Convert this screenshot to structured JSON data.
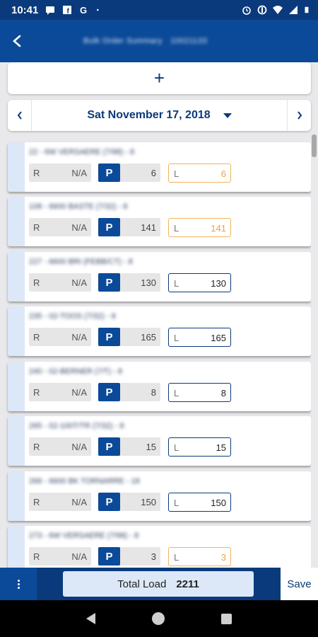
{
  "status_bar": {
    "time": "10:41",
    "left_icons": [
      "message-icon",
      "facebook-icon",
      "google-icon",
      "dot-icon"
    ],
    "right_icons": [
      "alarm-icon",
      "data-saver-icon",
      "wifi-icon",
      "signal-icon",
      "battery-icon"
    ]
  },
  "header": {
    "title": "Bulk Order Summary",
    "subtitle": "10021133"
  },
  "add_button": {
    "label": "+"
  },
  "date_nav": {
    "date": "Sat November 17, 2018",
    "prev_icon": "‹",
    "next_icon": "›"
  },
  "items": [
    {
      "name": "22 - 6W VERSAERE (7/98) - 8",
      "r_label": "R",
      "r_value": "N/A",
      "p_label": "P",
      "p_value": "6",
      "l_label": "L",
      "l_value": "6",
      "warn": true
    },
    {
      "name": "108 - 6600 BASTE (7/32) - 8",
      "r_label": "R",
      "r_value": "N/A",
      "p_label": "P",
      "p_value": "141",
      "l_label": "L",
      "l_value": "141",
      "warn": true
    },
    {
      "name": "227 - 6600 BRI (FEBB/CT) - 8",
      "r_label": "R",
      "r_value": "N/A",
      "p_label": "P",
      "p_value": "130",
      "l_label": "L",
      "l_value": "130",
      "warn": false
    },
    {
      "name": "235 - 02-TOOS (7/32) - 8",
      "r_label": "R",
      "r_value": "N/A",
      "p_label": "P",
      "p_value": "165",
      "l_label": "L",
      "l_value": "165",
      "warn": false
    },
    {
      "name": "240 - 02-BERNER (7/T) - 8",
      "r_label": "R",
      "r_value": "N/A",
      "p_label": "P",
      "p_value": "8",
      "l_label": "L",
      "l_value": "8",
      "warn": false
    },
    {
      "name": "265 - 02-100T/TR (7/32) - 8",
      "r_label": "R",
      "r_value": "N/A",
      "p_label": "P",
      "p_value": "15",
      "l_label": "L",
      "l_value": "15",
      "warn": false
    },
    {
      "name": "266 - 6600 BK TORNARRE - 18",
      "r_label": "R",
      "r_value": "N/A",
      "p_label": "P",
      "p_value": "150",
      "l_label": "L",
      "l_value": "150",
      "warn": false
    },
    {
      "name": "273 - 6W VERSAERE (7/98) - 8",
      "r_label": "R",
      "r_value": "N/A",
      "p_label": "P",
      "p_value": "3",
      "l_label": "L",
      "l_value": "3",
      "warn": true
    }
  ],
  "footer": {
    "menu_icon": "more-vert-icon",
    "total_label": "Total Load",
    "total_value": "2211",
    "save_label": "Save"
  },
  "colors": {
    "primary": "#0b4a98",
    "primary_dark": "#0a3a7c",
    "accent_light": "#dce8f7",
    "warning": "#f0a23e"
  }
}
